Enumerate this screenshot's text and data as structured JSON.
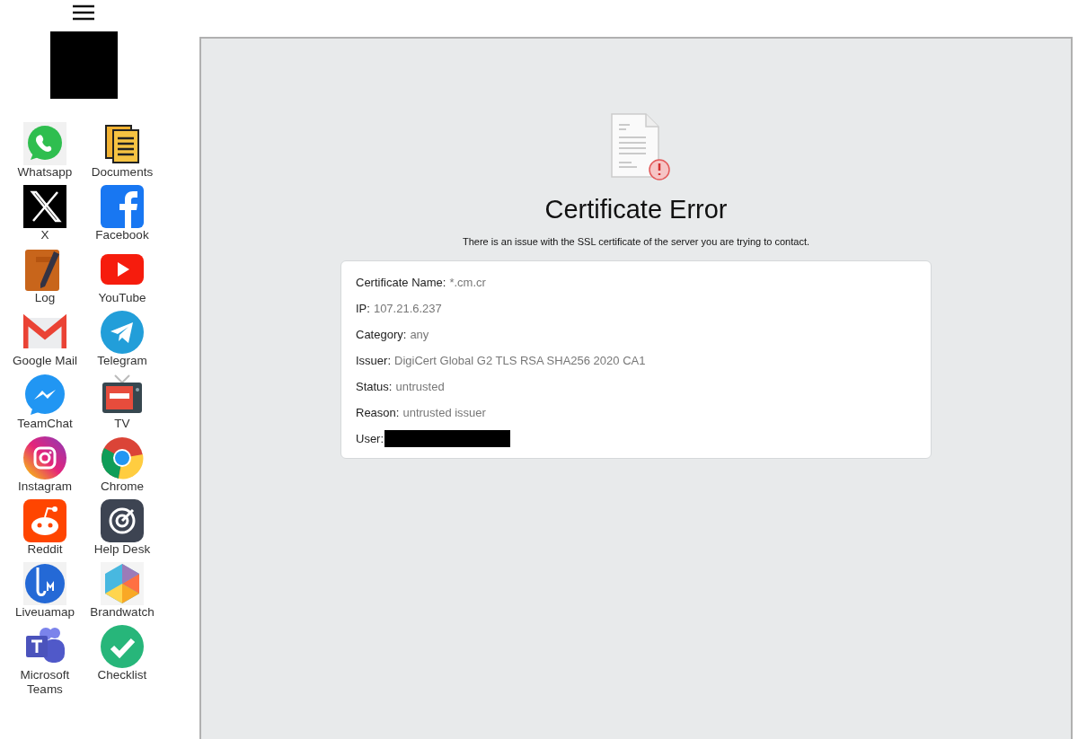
{
  "sidebar": {
    "apps": [
      {
        "name": "Whatsapp"
      },
      {
        "name": "Documents"
      },
      {
        "name": "X"
      },
      {
        "name": "Facebook"
      },
      {
        "name": "Log"
      },
      {
        "name": "YouTube"
      },
      {
        "name": "Google Mail"
      },
      {
        "name": "Telegram"
      },
      {
        "name": "TeamChat"
      },
      {
        "name": "TV"
      },
      {
        "name": "Instagram"
      },
      {
        "name": "Chrome"
      },
      {
        "name": "Reddit"
      },
      {
        "name": "Help Desk"
      },
      {
        "name": "Liveuamap"
      },
      {
        "name": "Brandwatch"
      },
      {
        "name": "Microsoft Teams"
      },
      {
        "name": "Checklist"
      }
    ]
  },
  "error": {
    "title": "Certificate Error",
    "message": "There is an issue with the SSL certificate of the server you are trying to contact.",
    "fields": [
      {
        "kind": "text",
        "label": "Certificate Name:",
        "value": "*.cm.cr"
      },
      {
        "kind": "text",
        "label": "IP:",
        "value": "107.21.6.237"
      },
      {
        "kind": "text",
        "label": "Category:",
        "value": "any"
      },
      {
        "kind": "text",
        "label": "Issuer:",
        "value": "DigiCert Global G2 TLS RSA SHA256 2020 CA1"
      },
      {
        "kind": "text",
        "label": "Status:",
        "value": "untrusted"
      },
      {
        "kind": "text",
        "label": "Reason:",
        "value": "untrusted issuer"
      },
      {
        "kind": "redacted",
        "label": "User:"
      }
    ]
  }
}
